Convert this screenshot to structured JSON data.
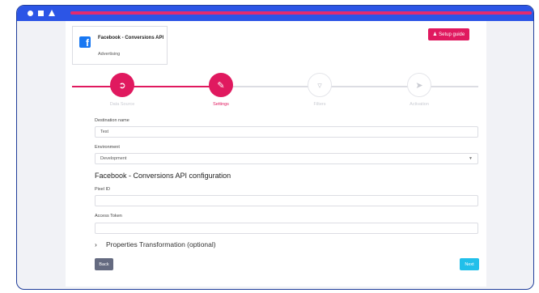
{
  "app": {
    "name": "Facebook - Conversions API",
    "category": "Advertising"
  },
  "header": {
    "setup_guide_label": "Setup guide"
  },
  "steps": [
    {
      "label": "Data Source",
      "icon": "sign-in-icon",
      "state": "completed"
    },
    {
      "label": "Settings",
      "icon": "pencil-icon",
      "state": "current"
    },
    {
      "label": "Filters",
      "icon": "filter-icon",
      "state": "upcoming"
    },
    {
      "label": "Activation",
      "icon": "send-icon",
      "state": "upcoming"
    }
  ],
  "form": {
    "destination_name": {
      "label": "Destination name",
      "value": "Test"
    },
    "environment": {
      "label": "Environment",
      "value": "Development"
    },
    "config_title": "Facebook - Conversions API configuration",
    "pixel_id": {
      "label": "Pixel ID",
      "value": ""
    },
    "access_token": {
      "label": "Access Token",
      "value": ""
    },
    "properties_transformation": "Properties Transformation (optional)"
  },
  "buttons": {
    "back": "Back",
    "next": "Next"
  },
  "colors": {
    "accent": "#e0195f",
    "titlebar": "#2c55e6",
    "next": "#21bfea",
    "back": "#646a80"
  }
}
